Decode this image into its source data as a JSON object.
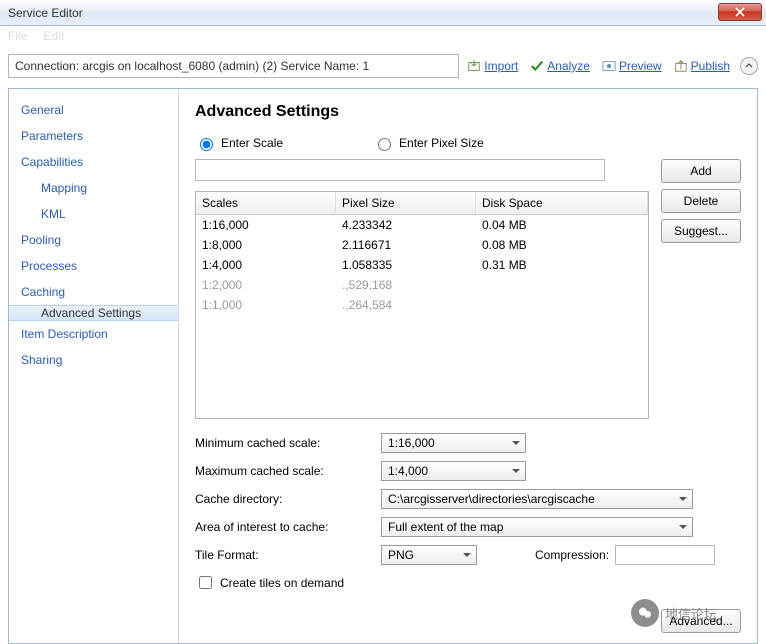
{
  "window": {
    "title": "Service Editor"
  },
  "toolbar": {
    "connection": "Connection: arcgis on localhost_6080 (admin) (2)   Service Name: 1",
    "import": "Import",
    "analyze": "Analyze",
    "preview": "Preview",
    "publish": "Publish"
  },
  "sidebar": {
    "general": "General",
    "parameters": "Parameters",
    "capabilities": "Capabilities",
    "mapping": "Mapping",
    "kml": "KML",
    "pooling": "Pooling",
    "processes": "Processes",
    "caching": "Caching",
    "advanced": "Advanced Settings",
    "item_desc": "Item Description",
    "sharing": "Sharing"
  },
  "page": {
    "heading": "Advanced Settings",
    "radio_scale": "Enter Scale",
    "radio_pixel": "Enter Pixel Size",
    "buttons": {
      "add": "Add",
      "delete": "Delete",
      "suggest": "Suggest...",
      "advanced_bottom": "Advanced..."
    },
    "table": {
      "headers": {
        "scales": "Scales",
        "pixel": "Pixel Size",
        "disk": "Disk Space"
      },
      "rows": [
        {
          "scale": "1:16,000",
          "pixel": "4.233342",
          "disk": "0.04 MB",
          "dim": false
        },
        {
          "scale": "1:8,000",
          "pixel": "2.116671",
          "disk": "0.08 MB",
          "dim": false
        },
        {
          "scale": "1:4,000",
          "pixel": "1.058335",
          "disk": "0.31 MB",
          "dim": false
        },
        {
          "scale": "1:2,000",
          "pixel": ".,529,168",
          "disk": "",
          "dim": true
        },
        {
          "scale": "1:1,000",
          "pixel": ".,264,584",
          "disk": "",
          "dim": true
        }
      ]
    },
    "labels": {
      "min_scale": "Minimum cached scale:",
      "max_scale": "Maximum cached scale:",
      "cache_dir": "Cache directory:",
      "aoi": "Area of interest to cache:",
      "tile_fmt": "Tile Format:",
      "compression": "Compression:",
      "create_tiles": "Create tiles on demand"
    },
    "values": {
      "min_scale": "1:16,000",
      "max_scale": "1:4,000",
      "cache_dir": "C:\\arcgisserver\\directories\\arcgiscache",
      "aoi": "Full extent of the map",
      "tile_fmt": "PNG"
    }
  },
  "watermark": "地信论坛"
}
